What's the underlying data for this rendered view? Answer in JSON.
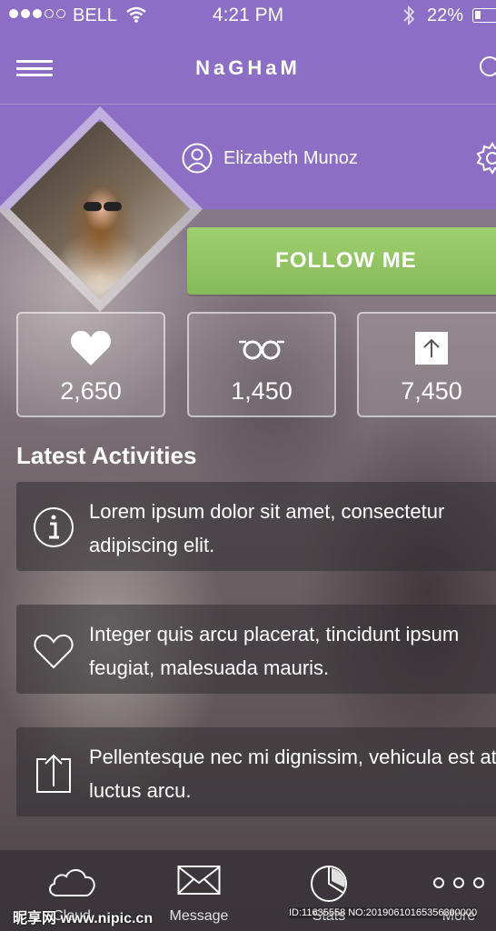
{
  "status": {
    "carrier": "BELL",
    "time": "4:21 PM",
    "battery": "22%"
  },
  "nav": {
    "title": "NaGHaM"
  },
  "profile": {
    "name": "Elizabeth Munoz",
    "follow_label": "FOLLOW ME"
  },
  "stats": [
    {
      "icon": "heart-icon",
      "value": "2,650"
    },
    {
      "icon": "glasses-icon",
      "value": "1,450"
    },
    {
      "icon": "share-icon",
      "value": "7,450"
    }
  ],
  "activities": {
    "title": "Latest Activities",
    "items": [
      {
        "icon": "info-icon",
        "text": "Lorem ipsum dolor sit amet, consectetur adipiscing elit."
      },
      {
        "icon": "heart-outline-icon",
        "text": "Integer quis arcu placerat, tincidunt ipsum feugiat, malesuada mauris."
      },
      {
        "icon": "upload-icon",
        "text": "Pellentesque nec mi dignissim, vehicula est at, luctus arcu."
      }
    ]
  },
  "tabs": [
    {
      "icon": "cloud-icon",
      "label": "Cloud"
    },
    {
      "icon": "envelope-icon",
      "label": "Message"
    },
    {
      "icon": "pie-chart-icon",
      "label": "Stats"
    },
    {
      "icon": "more-icon",
      "label": "More"
    }
  ],
  "watermark": {
    "brand": "昵享网 www.nipic.cn",
    "id": "ID:11635558 NO:20190610165356300000"
  },
  "colors": {
    "header": "#8c6ec8",
    "follow_button": "#93c464"
  }
}
